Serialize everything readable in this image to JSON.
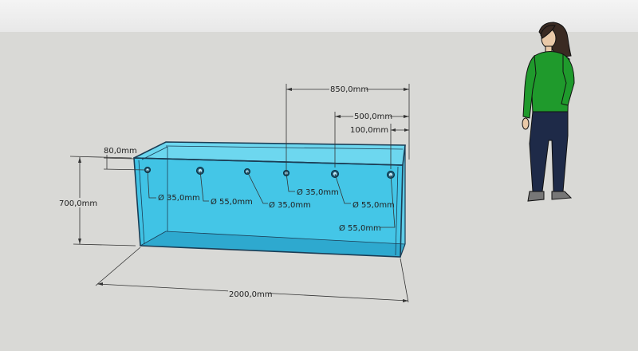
{
  "dimensions": {
    "overall_width": "2000,0mm",
    "height": "700,0mm",
    "top_offset": "80,0mm",
    "hole_distance_850": "850,0mm",
    "hole_distance_500": "500,0mm",
    "hole_distance_100": "100,0mm"
  },
  "holes": [
    {
      "label": "Ø 35,0mm"
    },
    {
      "label": "Ø 55,0mm"
    },
    {
      "label": "Ø 35,0mm"
    },
    {
      "label": "Ø 35,0mm"
    },
    {
      "label": "Ø 55,0mm"
    },
    {
      "label": "Ø 55,0mm"
    }
  ],
  "colors": {
    "tank_front": "#3fc4e6",
    "tank_side": "#2fa9d0",
    "tank_top": "#55d3ef",
    "edge": "#1b3d55",
    "ground": "#d9d9d6",
    "sky": "#eeeeee",
    "shirt": "#1f9a2c",
    "jeans": "#1e2a48"
  },
  "figure": {
    "icon": "person-scale-figure"
  }
}
